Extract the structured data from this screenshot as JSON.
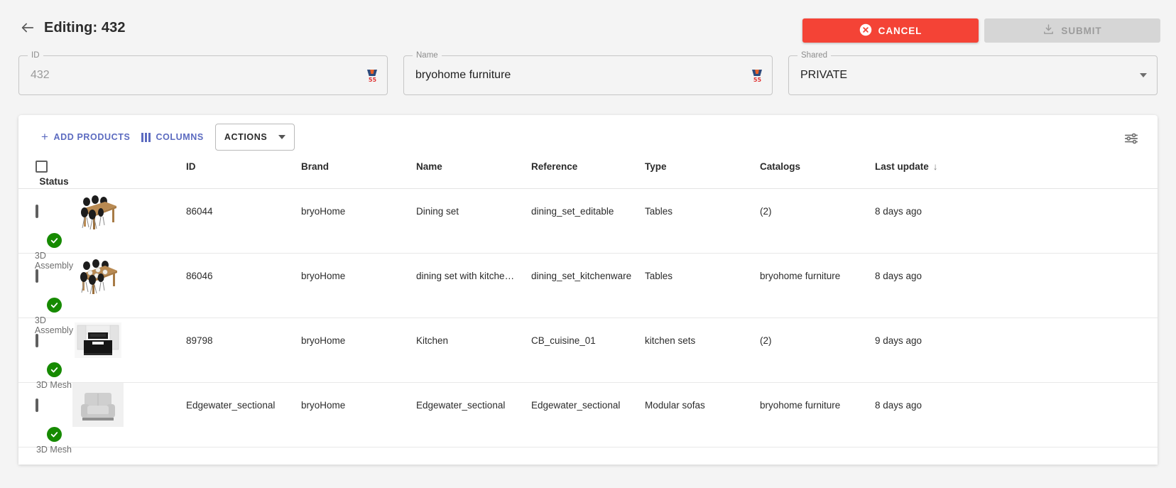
{
  "header": {
    "back_icon": "arrow-left-icon",
    "title": "Editing: 432",
    "cancel_label": "CANCEL",
    "cancel_icon": "cancel-circle-icon",
    "cancel_color": "#f44336",
    "submit_label": "SUBMIT",
    "submit_icon": "download-icon",
    "submit_disabled": true
  },
  "form": {
    "id_field": {
      "label": "ID",
      "value": "432",
      "is_placeholder": true,
      "badge_count": "55"
    },
    "name_field": {
      "label": "Name",
      "value": "bryohome furniture",
      "is_placeholder": false,
      "badge_count": "55"
    },
    "shared_field": {
      "label": "Shared",
      "value": "PRIVATE"
    }
  },
  "toolbar": {
    "add_products_label": "ADD PRODUCTS",
    "add_products_icon": "plus-icon",
    "columns_label": "COLUMNS",
    "columns_icon": "columns-icon",
    "actions_label": "ACTIONS",
    "actions_caret_icon": "chevron-down-icon",
    "tune_icon": "tune-sliders-icon",
    "link_color": "#5c6bc0"
  },
  "table": {
    "columns": [
      "",
      "",
      "ID",
      "Brand",
      "Name",
      "Reference",
      "Type",
      "Catalogs",
      "Last update",
      "Status"
    ],
    "headers": {
      "id": "ID",
      "brand": "Brand",
      "name": "Name",
      "reference": "Reference",
      "type": "Type",
      "catalogs": "Catalogs",
      "last_update": "Last update",
      "status": "Status"
    },
    "sort_column": "Last update",
    "sort_direction": "desc",
    "sort_arrow_glyph": "↓",
    "rows": [
      {
        "id": "86044",
        "brand": "bryoHome",
        "name": "Dining set",
        "reference": "dining_set_editable",
        "type": "Tables",
        "catalogs": "(2)",
        "last_update": "8 days ago",
        "status_text": "3D Assembly",
        "status_icon": "check-circle-icon",
        "status_color": "#168a00",
        "thumbnail": "dining-table-with-black-chairs"
      },
      {
        "id": "86046",
        "brand": "bryoHome",
        "name": "dining set with kitche…",
        "reference": "dining_set_kitchenware",
        "type": "Tables",
        "catalogs": "bryohome furniture",
        "last_update": "8 days ago",
        "status_text": "3D Assembly",
        "status_icon": "check-circle-icon",
        "status_color": "#168a00",
        "thumbnail": "dining-table-with-tableware"
      },
      {
        "id": "89798",
        "brand": "bryoHome",
        "name": "Kitchen",
        "reference": "CB_cuisine_01",
        "type": "kitchen sets",
        "catalogs": "(2)",
        "last_update": "9 days ago",
        "status_text": "3D Mesh",
        "status_icon": "check-circle-icon",
        "status_color": "#168a00",
        "thumbnail": "kitchen-island-black-white"
      },
      {
        "id": "Edgewater_sectional",
        "brand": "bryoHome",
        "name": "Edgewater_sectional",
        "reference": "Edgewater_sectional",
        "type": "Modular sofas",
        "catalogs": "bryohome furniture",
        "last_update": "8 days ago",
        "status_text": "3D Mesh",
        "status_icon": "check-circle-icon",
        "status_color": "#168a00",
        "thumbnail": "grey-armchair"
      }
    ]
  }
}
